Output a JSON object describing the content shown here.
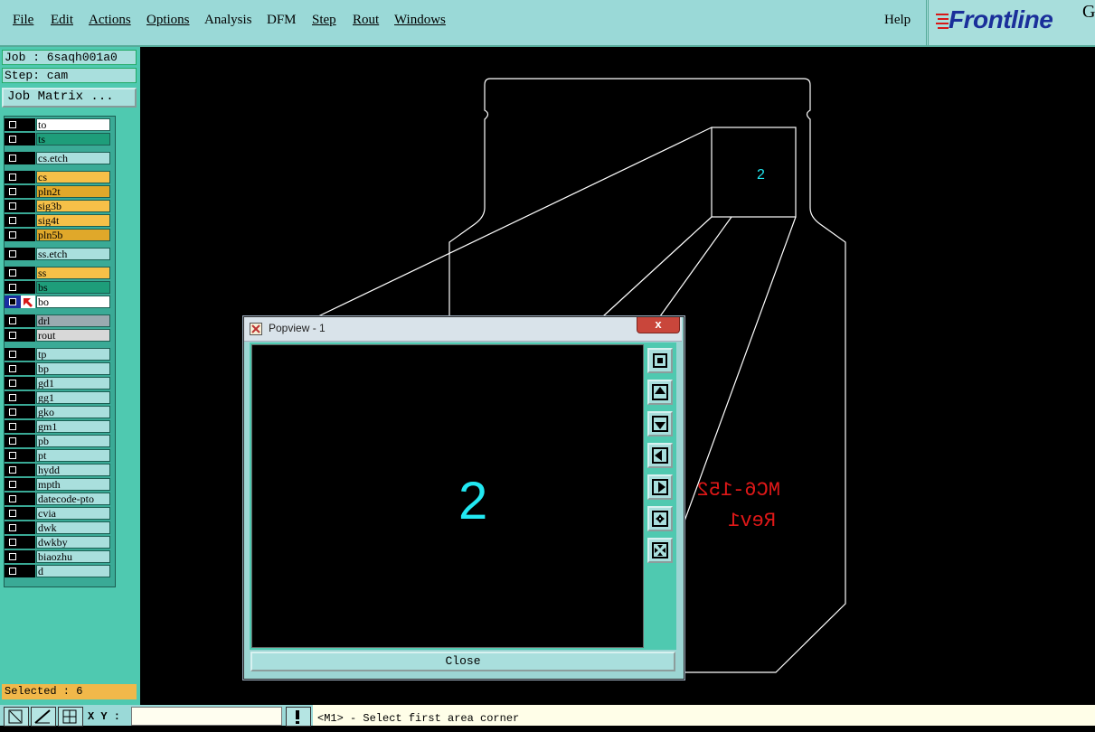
{
  "menubar": {
    "items": [
      {
        "label": "File"
      },
      {
        "label": "Edit"
      },
      {
        "label": "Actions"
      },
      {
        "label": "Options"
      },
      {
        "label": "Analysis"
      },
      {
        "label": "DFM"
      },
      {
        "label": "Step"
      },
      {
        "label": "Rout"
      },
      {
        "label": "Windows"
      }
    ],
    "help": "Help",
    "logo": "Frontline",
    "logo_suffix": "G"
  },
  "job": {
    "job_line": "Job : 6saqh001a0",
    "step_line": "Step: cam",
    "matrix_button": "Job Matrix ..."
  },
  "layers": [
    {
      "name": "to",
      "color": "#ffffff"
    },
    {
      "name": "ts",
      "color": "#1e9d7a"
    },
    {
      "name": "cs.etch",
      "color": "#a9dfdd"
    },
    {
      "name": "cs",
      "color": "#f6c048"
    },
    {
      "name": "pln2t",
      "color": "#e0a82a"
    },
    {
      "name": "sig3b",
      "color": "#f6c048"
    },
    {
      "name": "sig4t",
      "color": "#f6c048"
    },
    {
      "name": "pln5b",
      "color": "#e0a82a"
    },
    {
      "name": "ss.etch",
      "color": "#a9dfdd"
    },
    {
      "name": "ss",
      "color": "#f6c048"
    },
    {
      "name": "bs",
      "color": "#1e9d7a"
    },
    {
      "name": "bo",
      "color": "#ffffff"
    },
    {
      "name": "drl",
      "color": "#9aaab0"
    },
    {
      "name": "rout",
      "color": "#d8d8d8"
    },
    {
      "name": "tp",
      "color": "#a9dfdd"
    },
    {
      "name": "bp",
      "color": "#a9dfdd"
    },
    {
      "name": "gd1",
      "color": "#a9dfdd"
    },
    {
      "name": "gg1",
      "color": "#a9dfdd"
    },
    {
      "name": "gko",
      "color": "#a9dfdd"
    },
    {
      "name": "gm1",
      "color": "#a9dfdd"
    },
    {
      "name": "pb",
      "color": "#a9dfdd"
    },
    {
      "name": "pt",
      "color": "#a9dfdd"
    },
    {
      "name": "hydd",
      "color": "#a9dfdd"
    },
    {
      "name": "mpth",
      "color": "#a9dfdd"
    },
    {
      "name": "datecode-pto",
      "color": "#a9dfdd"
    },
    {
      "name": "cvia",
      "color": "#a9dfdd"
    },
    {
      "name": "dwk",
      "color": "#a9dfdd"
    },
    {
      "name": "dwkby",
      "color": "#a9dfdd"
    },
    {
      "name": "biaozhu",
      "color": "#a9dfdd"
    },
    {
      "name": "d",
      "color": "#a9dfdd"
    }
  ],
  "selected": "Selected : 6",
  "canvas": {
    "label_small": "2",
    "silk_line1": "MC6-152",
    "silk_line2": "Rev1",
    "line_color": "#ffffff",
    "text_color": "#22e8f2",
    "silk_color": "#e01818"
  },
  "popview": {
    "title": "Popview - 1",
    "close_x": "x",
    "big_label": "2",
    "close_button": "Close",
    "tools": [
      "zoom-home-icon",
      "pan-up-icon",
      "pan-down-icon",
      "pan-left-icon",
      "pan-right-icon",
      "zoom-in-icon",
      "zoom-out-icon"
    ]
  },
  "status": {
    "xy_label": "X Y :",
    "xy_value": "",
    "prompt": "<M1> - Select first area corner"
  }
}
